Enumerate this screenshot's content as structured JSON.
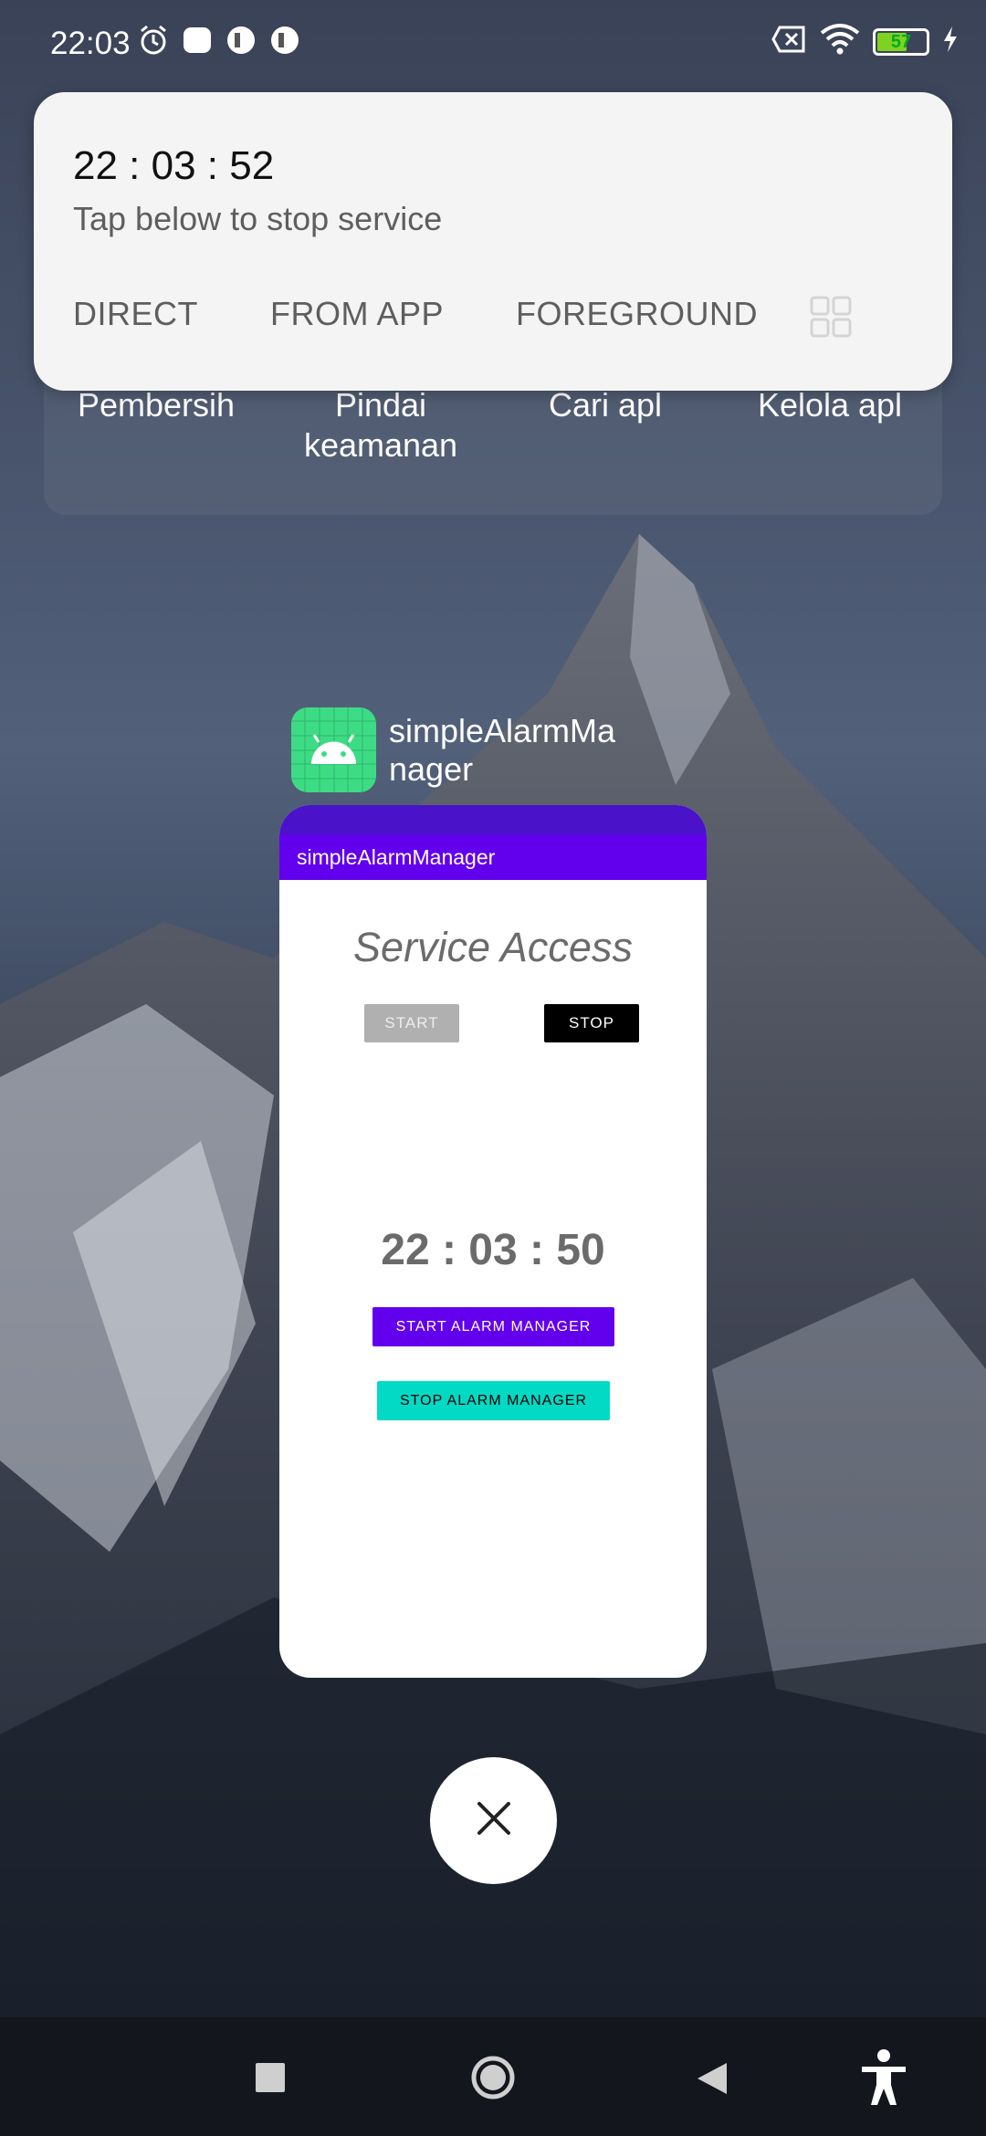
{
  "status_bar": {
    "time": "22:03",
    "battery": "57",
    "left_icons": [
      "alarm-clock-icon",
      "app-notification-icon",
      "app-notification-icon",
      "app-notification-icon"
    ],
    "right_icons": [
      "sim-off-icon",
      "wifi-icon",
      "battery-icon",
      "charging-bolt-icon"
    ]
  },
  "quick_panel": {
    "items": [
      {
        "label": "Pembersih"
      },
      {
        "label": "Pindai\nkeamanan"
      },
      {
        "label": "Cari apl"
      },
      {
        "label": "Kelola apl"
      }
    ]
  },
  "notification": {
    "time": "22 : 03 : 52",
    "subtitle": "Tap below to stop service",
    "actions": [
      "DIRECT",
      "FROM APP",
      "FOREGROUND"
    ]
  },
  "recent_app": {
    "name": "simpleAlarmMa\nnager",
    "toolbar_title": "simpleAlarmManager",
    "service_title": "Service Access",
    "start_label": "START",
    "stop_label": "STOP",
    "timer": "22 : 03 : 50",
    "start_alarm_label": "START ALARM MANAGER",
    "stop_alarm_label": "STOP ALARM MANAGER"
  },
  "colors": {
    "accent": "#6200ee",
    "secondary": "#03dac5",
    "app_icon": "#3ddc84"
  }
}
